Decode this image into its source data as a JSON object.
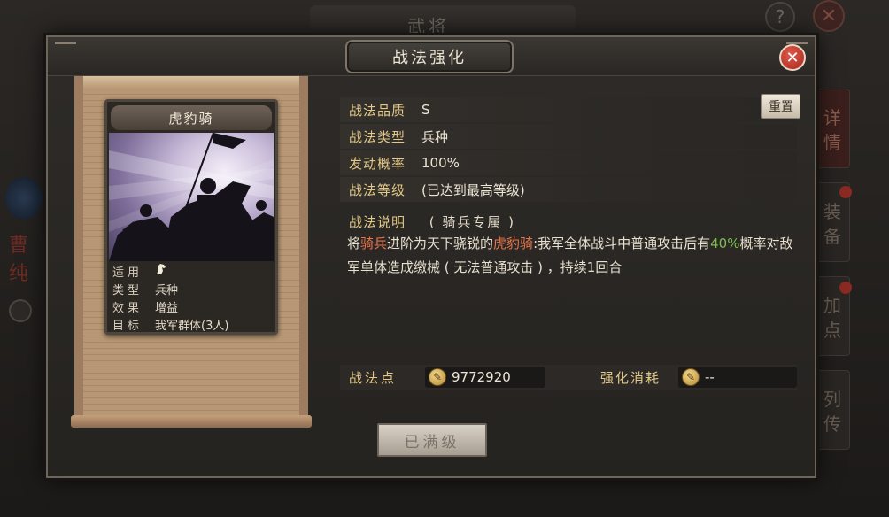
{
  "background": {
    "title": "武将",
    "help_glyph": "?",
    "close_glyph": "✕",
    "left_name": "曹纯",
    "right_tabs": [
      "详情",
      "装备",
      "加点",
      "列传"
    ]
  },
  "dialog": {
    "title": "战法强化",
    "close_glyph": "✕"
  },
  "card": {
    "name": "虎豹骑",
    "stats": [
      {
        "key": "适用",
        "value": "",
        "icon": "horse-icon"
      },
      {
        "key": "类型",
        "value": "兵种"
      },
      {
        "key": "效果",
        "value": "增益"
      },
      {
        "key": "目标",
        "value": "我军群体(3人)"
      }
    ]
  },
  "info": {
    "rows": [
      {
        "label": "战法品质",
        "value": "S"
      },
      {
        "label": "战法类型",
        "value": "兵种"
      },
      {
        "label": "发动概率",
        "value": "100%"
      },
      {
        "label": "战法等级",
        "value": "(已达到最高等级)"
      }
    ],
    "reset_label": "重置",
    "desc_label": "战法说明",
    "desc_sub": "( 骑兵专属 )",
    "desc": {
      "p1": "将",
      "h1": "骑兵",
      "p2": "进阶为天下骁锐的",
      "h2": "虎豹骑",
      "p3": ":我军全体战斗中普通攻击后有",
      "h3": "40%",
      "p4": "概率对敌军单体造成缴械 ( 无法普通攻击 ) ，持续1回合"
    }
  },
  "points": {
    "label": "战法点",
    "value": "9772920",
    "cost_label": "强化消耗",
    "cost_value": "--"
  },
  "max_button_label": "已满级",
  "colors": {
    "label_gold": "#e3c987",
    "highlight_orange": "#e8754a",
    "highlight_green": "#7fbf52",
    "close_red": "#c0392b"
  }
}
